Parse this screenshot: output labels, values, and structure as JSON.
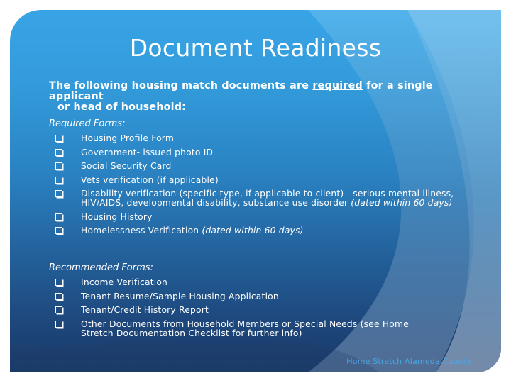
{
  "slide": {
    "title": "Document Readiness",
    "intro": {
      "before": "The following housing match documents are ",
      "emphasis": "required",
      "after": " for a single applicant",
      "line2": "or head of household:"
    },
    "required_label": "Required Forms:",
    "required_items": [
      {
        "text": "Housing Profile Form",
        "note": ""
      },
      {
        "text": "Government- issued photo ID",
        "note": ""
      },
      {
        "text": "Social Security Card",
        "note": ""
      },
      {
        "text": "Vets verification (if applicable)",
        "note": ""
      },
      {
        "text": "Disability verification (specific type, if applicable to client) - serious mental illness, HIV/AIDS, developmental disability, substance use disorder ",
        "note": "(dated within 60 days)"
      },
      {
        "text": "Housing History",
        "note": ""
      },
      {
        "text": "Homelessness Verification ",
        "note": "(dated within 60 days)"
      }
    ],
    "recommended_label": "Recommended Forms:",
    "recommended_items": [
      {
        "text": "Income Verification"
      },
      {
        "text": "Tenant Resume/Sample Housing Application"
      },
      {
        "text": "Tenant/Credit History Report"
      },
      {
        "text": "Other Documents from Household Members or Special Needs (see Home Stretch Documentation Checklist for further info)"
      }
    ],
    "footer": "Home Stretch Alameda County",
    "bullet_icon": "hollow-square-bullet",
    "colors": {
      "bg_top": "#38a4e6",
      "bg_bottom": "#1b3a68",
      "text": "#ffffff",
      "footer": "#4aa6e4"
    }
  }
}
